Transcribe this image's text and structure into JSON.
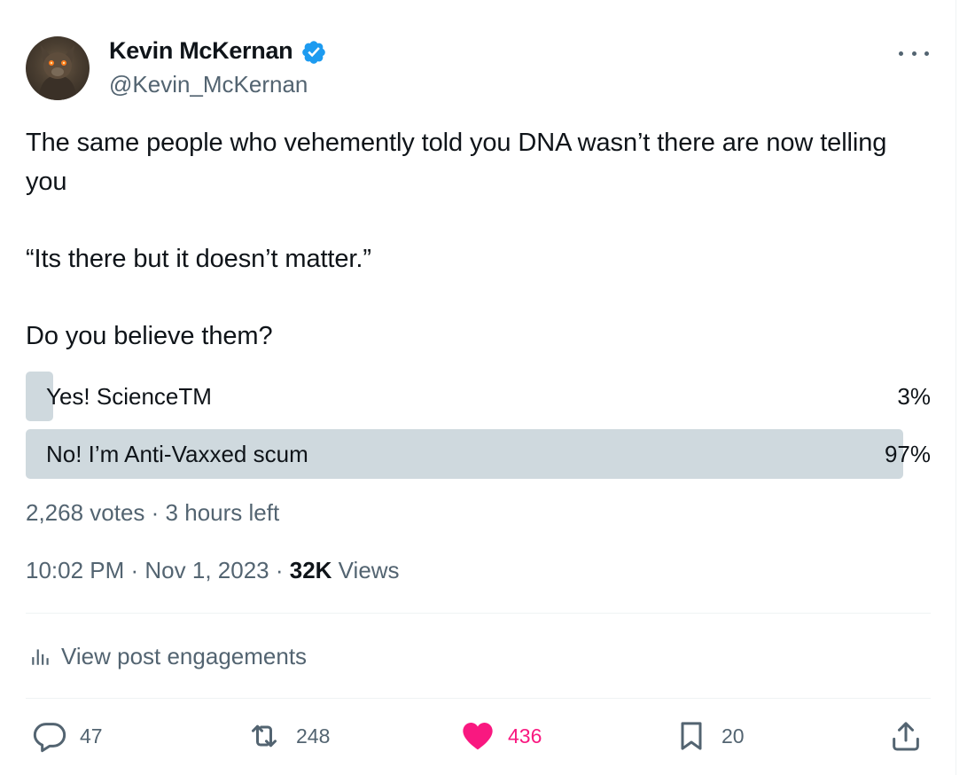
{
  "author": {
    "name": "Kevin McKernan",
    "handle": "@Kevin_McKernan",
    "verified": true,
    "verified_color": "#1d9bf0"
  },
  "tweet": {
    "lines": [
      "The same people who vehemently told you DNA wasn’t there are now telling you",
      "“Its there but it doesn’t matter.”",
      "Do you believe them?"
    ]
  },
  "poll": {
    "options": [
      {
        "label": "Yes! ScienceTM",
        "percent_label": "3%",
        "percent": 3
      },
      {
        "label": "No! I’m Anti-Vaxxed scum",
        "percent_label": "97%",
        "percent": 97
      }
    ],
    "votes": "2,268 votes",
    "separator": " · ",
    "time_left": "3 hours left",
    "bar_color": "#cfd9de"
  },
  "meta": {
    "time": "10:02 PM",
    "sep": " · ",
    "date": "Nov 1, 2023",
    "views_count": "32K",
    "views_label": "Views"
  },
  "engagements": {
    "label": "View post engagements",
    "icon": "analytics-icon"
  },
  "actions": {
    "replies": "47",
    "reposts": "248",
    "likes": "436",
    "bookmarks": "20",
    "like_color": "#f91880",
    "muted_color": "#536471"
  }
}
